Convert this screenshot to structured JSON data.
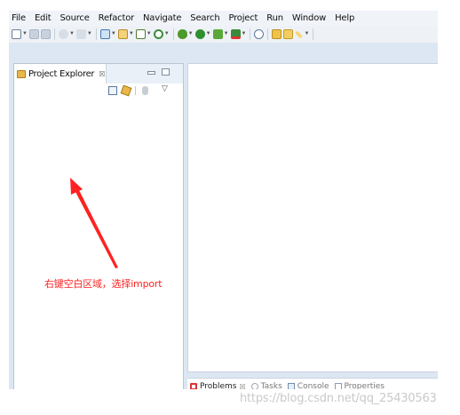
{
  "menubar": {
    "items": [
      "File",
      "Edit",
      "Source",
      "Refactor",
      "Navigate",
      "Search",
      "Project",
      "Run",
      "Window",
      "Help"
    ]
  },
  "toolbar": {
    "icons": [
      "new-icon",
      "save-icon",
      "save-all-icon",
      "back-icon",
      "forward-icon",
      "open-type-icon",
      "new-folder-icon",
      "new-class-icon",
      "refresh-icon",
      "debug-icon",
      "run-icon",
      "run-external-icon",
      "coverage-icon",
      "search-icon",
      "open-folder-icon",
      "edit-icon"
    ],
    "colors": {
      "debug": "#4c9a2a",
      "run": "#2f8f2f",
      "accent": "#e9b84a"
    }
  },
  "explorer": {
    "tab_label": "Project Explorer",
    "tab_close": "☒",
    "view_menu": "▽"
  },
  "bottom_panel": {
    "tabs": [
      {
        "label": "Problems",
        "close": "☒"
      },
      {
        "label": "Tasks"
      },
      {
        "label": "Console"
      },
      {
        "label": "Properties"
      }
    ]
  },
  "annotation": {
    "text": "右键空白区域，选择import",
    "color": "#ff2222"
  },
  "watermark": {
    "text": "https://blog.csdn.net/qq_25430563"
  }
}
